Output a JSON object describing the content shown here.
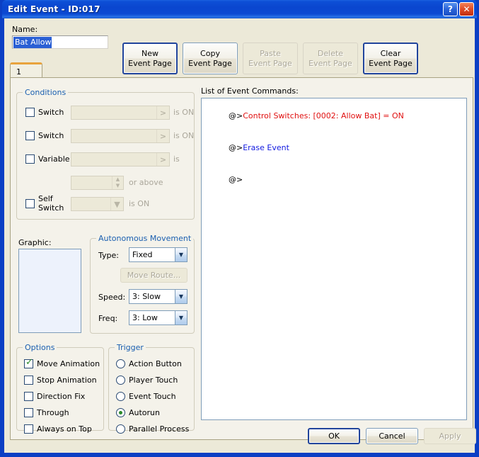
{
  "window": {
    "title": "Edit Event - ID:017",
    "help_button": "?",
    "close_button": "✕"
  },
  "header": {
    "name_label": "Name:",
    "name_value": "Bat Allow",
    "page_buttons": [
      {
        "line1": "New",
        "line2": "Event Page",
        "state": "default"
      },
      {
        "line1": "Copy",
        "line2": "Event Page",
        "state": "normal"
      },
      {
        "line1": "Paste",
        "line2": "Event Page",
        "state": "disabled"
      },
      {
        "line1": "Delete",
        "line2": "Event Page",
        "state": "disabled"
      },
      {
        "line1": "Clear",
        "line2": "Event Page",
        "state": "normal"
      }
    ]
  },
  "tabs": [
    {
      "label": "1",
      "selected": true
    }
  ],
  "conditions": {
    "title": "Conditions",
    "rows": [
      {
        "check_label": "Switch",
        "checked": false,
        "value": "",
        "suffix": "is ON"
      },
      {
        "check_label": "Switch",
        "checked": false,
        "value": "",
        "suffix": "is ON"
      },
      {
        "check_label": "Variable",
        "checked": false,
        "value": "",
        "suffix": "is"
      },
      {
        "check_label": "",
        "checked": null,
        "value": "",
        "suffix": "or above"
      },
      {
        "check_label": "Self Switch",
        "checked": false,
        "value": "",
        "suffix": "is ON"
      }
    ]
  },
  "graphic": {
    "label": "Graphic:",
    "preview": ""
  },
  "autonomous_movement": {
    "title": "Autonomous Movement",
    "type_label": "Type:",
    "type_value": "Fixed",
    "move_route_button": "Move Route...",
    "move_route_enabled": false,
    "speed_label": "Speed:",
    "speed_value": "3: Slow",
    "freq_label": "Freq:",
    "freq_value": "3: Low"
  },
  "options": {
    "title": "Options",
    "items": [
      {
        "label": "Move Animation",
        "checked": true
      },
      {
        "label": "Stop Animation",
        "checked": false
      },
      {
        "label": "Direction Fix",
        "checked": false
      },
      {
        "label": "Through",
        "checked": false
      },
      {
        "label": "Always on Top",
        "checked": false
      }
    ]
  },
  "trigger": {
    "title": "Trigger",
    "items": [
      {
        "label": "Action Button",
        "selected": false
      },
      {
        "label": "Player Touch",
        "selected": false
      },
      {
        "label": "Event Touch",
        "selected": false
      },
      {
        "label": "Autorun",
        "selected": true
      },
      {
        "label": "Parallel Process",
        "selected": false
      }
    ]
  },
  "commands": {
    "label": "List of Event Commands:",
    "lines": [
      {
        "marker": "@>",
        "text": "Control Switches: [0002: Allow Bat] = ON",
        "color": "#e01010"
      },
      {
        "marker": "@>",
        "text": "Erase Event",
        "color": "#1018e0"
      },
      {
        "marker": "@>",
        "text": "",
        "color": "#000000"
      }
    ]
  },
  "footer": {
    "ok": "OK",
    "cancel": "Cancel",
    "apply": "Apply",
    "apply_enabled": false
  },
  "colors": {
    "titlebar": "#0b49d2",
    "dialog_face": "#ece9d8",
    "tabpage_face": "#f4f2ea",
    "group_title": "#1a5fb0",
    "tab_accent": "#e8a33d",
    "checked": "#2a8a2a",
    "selection": "#2a5fd4"
  }
}
